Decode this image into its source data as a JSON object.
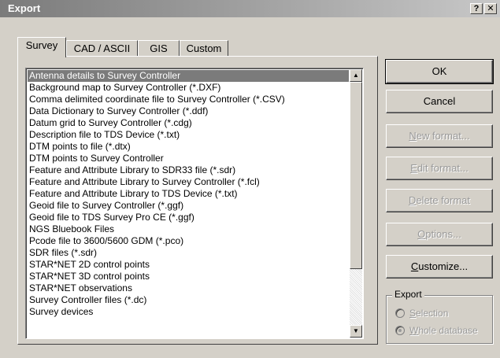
{
  "window": {
    "title": "Export",
    "help_glyph": "?",
    "close_glyph": "✕"
  },
  "tabs": [
    {
      "label": "Survey",
      "active": true
    },
    {
      "label": "CAD / ASCII",
      "active": false
    },
    {
      "label": "GIS",
      "active": false
    },
    {
      "label": "Custom",
      "active": false
    }
  ],
  "list": {
    "items": [
      "Antenna details to Survey Controller",
      "Background map to Survey Controller (*.DXF)",
      "Comma delimited coordinate file to Survey Controller (*.CSV)",
      "Data Dictionary to Survey Controller (*.ddf)",
      "Datum grid to Survey Controller (*.cdg)",
      "Description file to TDS Device (*.txt)",
      "DTM points to file (*.dtx)",
      "DTM points to Survey Controller",
      "Feature and Attribute Library to SDR33 file (*.sdr)",
      "Feature and Attribute Library to Survey Controller (*.fcl)",
      "Feature and Attribute Library to TDS Device (*.txt)",
      "Geoid file to Survey Controller (*.ggf)",
      "Geoid file to TDS Survey Pro CE (*.ggf)",
      "NGS Bluebook Files",
      "Pcode file to 3600/5600 GDM (*.pco)",
      "SDR files (*.sdr)",
      "STAR*NET 2D control points",
      "STAR*NET 3D control points",
      "STAR*NET observations",
      "Survey Controller files (*.dc)",
      "Survey devices"
    ],
    "selected_index": 0
  },
  "buttons": {
    "ok": "OK",
    "cancel": "Cancel",
    "new_format_first": "N",
    "new_format_rest": "ew format...",
    "edit_format_first": "E",
    "edit_format_rest": "dit format...",
    "delete_format_first": "D",
    "delete_format_rest": "elete format",
    "options_first": "O",
    "options_rest": "ptions...",
    "customize_first": "C",
    "customize_rest": "ustomize..."
  },
  "export_group": {
    "label": "Export",
    "selection_first": "S",
    "selection_rest": "election",
    "whole_first": "W",
    "whole_rest": "hole database",
    "selected": "whole_database"
  },
  "colors": {
    "selection_bg": "#7b7b7b",
    "disabled_text": "#9a9a9a",
    "face": "#d4d0c8"
  }
}
